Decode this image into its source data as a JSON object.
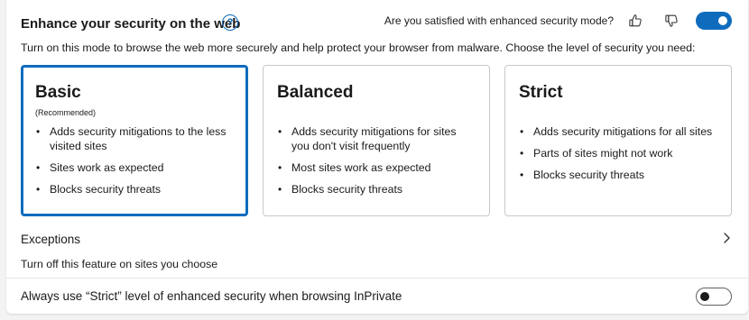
{
  "section": {
    "title": "Enhance your security on the web",
    "help_icon": "question-circle-icon",
    "feedback_question": "Are you satisfied with enhanced security mode?",
    "thumbs_up_icon": "thumbs-up-icon",
    "thumbs_down_icon": "thumbs-down-icon",
    "enabled": true,
    "description": "Turn on this mode to browse the web more securely and help protect your browser from malware. Choose the level of security you need:"
  },
  "levels": [
    {
      "title": "Basic",
      "subtitle": "(Recommended)",
      "selected": true,
      "bullets": [
        "Adds security mitigations to the less visited sites",
        "Sites work as expected",
        "Blocks security threats"
      ]
    },
    {
      "title": "Balanced",
      "subtitle": "",
      "selected": false,
      "bullets": [
        "Adds security mitigations for sites you don't visit frequently",
        "Most sites work as expected",
        "Blocks security threats"
      ]
    },
    {
      "title": "Strict",
      "subtitle": "",
      "selected": false,
      "bullets": [
        "Adds security mitigations for all sites",
        "Parts of sites might not work",
        "Blocks security threats"
      ]
    }
  ],
  "bullet_char": "•",
  "exceptions": {
    "title": "Exceptions",
    "description": "Turn off this feature on sites you choose",
    "chevron_icon": "chevron-right-icon"
  },
  "inprivate": {
    "label": "Always use “Strict” level of enhanced security when browsing InPrivate",
    "enabled": false
  },
  "colors": {
    "accent": "#0f6cbd",
    "card_border": "#c8c8c8",
    "background": "#f3f3f3",
    "panel": "#ffffff"
  }
}
